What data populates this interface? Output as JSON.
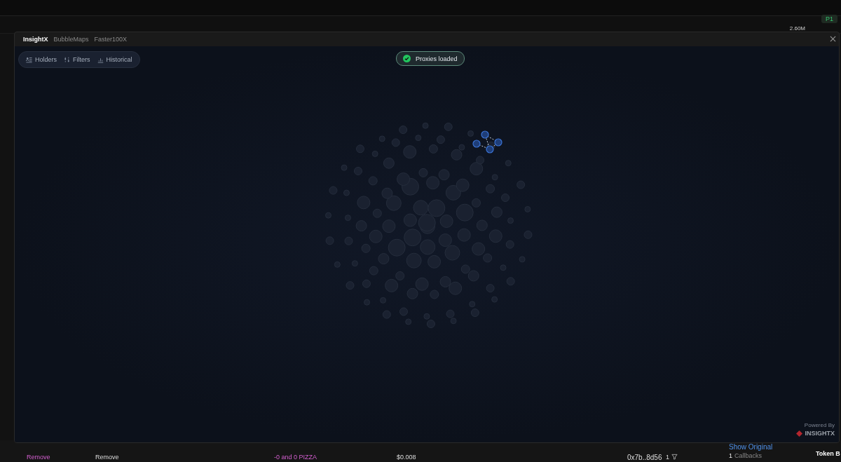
{
  "tabs": [
    {
      "label": "InsightX",
      "selected": true
    },
    {
      "label": "BubbleMaps",
      "selected": false
    },
    {
      "label": "Faster100X",
      "selected": false
    }
  ],
  "toolbar": [
    {
      "label": "Holders",
      "kind": "holders"
    },
    {
      "label": "Filters",
      "kind": "filters"
    },
    {
      "label": "Historical",
      "kind": "historical"
    }
  ],
  "toast": {
    "text": "Proxies loaded"
  },
  "branding": {
    "caption": "Powered By",
    "name": "INSIGHTX"
  },
  "background": {
    "price_label": "2.60M",
    "badge": "P1",
    "trade_row": {
      "type": "Remove",
      "cells": [
        "Remove",
        "-0 and 0 PIZZA",
        "$0.008"
      ],
      "maker": "0x7b..8d56",
      "count": "1"
    },
    "side_panel": {
      "link": "Show Original",
      "callback_count": "1",
      "callbacks_label": "Callbacks"
    },
    "tab": "Token B"
  }
}
